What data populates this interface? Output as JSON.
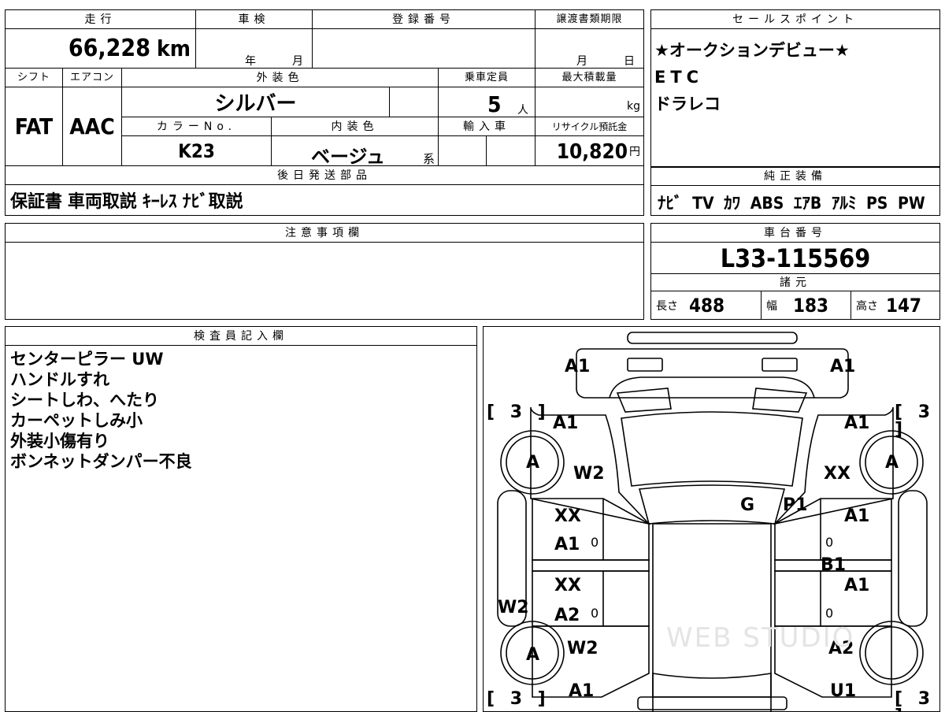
{
  "main": {
    "headers": {
      "mileage": "走行",
      "inspection": "車検",
      "registration_no": "登録番号",
      "transfer_deadline": "譲渡書類期限",
      "shift": "シフト",
      "aircon": "エアコン",
      "exterior_color": "外装色",
      "capacity": "乗車定員",
      "max_load": "最大積載量",
      "color_no": "カラーNo.",
      "interior_color": "内装色",
      "import": "輸入車",
      "recycle_fee": "リサイクル預託金",
      "later_parts": "後日発送部品"
    },
    "mileage_value": "66,228",
    "mileage_unit": "km",
    "inspection_year": "年",
    "inspection_month": "月",
    "transfer_month": "月",
    "transfer_day": "日",
    "shift_value": "FAT",
    "aircon_value": "AAC",
    "exterior_color_value": "シルバー",
    "capacity_value": "5",
    "capacity_unit": "人",
    "max_load_unit": "kg",
    "color_no_value": "K23",
    "interior_color_value": "ベージュ",
    "interior_color_suffix": "系",
    "recycle_fee_value": "10,820",
    "recycle_fee_unit": "円",
    "later_parts_value": "保証書 車両取説 ｷｰﾚｽ ﾅﾋﾞ取説"
  },
  "sales": {
    "header": "セールスポイント",
    "lines": [
      "★オークションデビュー★",
      "ETC",
      "ドラレコ"
    ]
  },
  "equipment": {
    "header": "純正装備",
    "value": "ﾅﾋﾞ TV ｶﾜ ABS ｴｱB ｱﾙﾐ PS PW"
  },
  "notes": {
    "header": "注意事項欄"
  },
  "chassis": {
    "header": "車台番号",
    "value": "L33-115569",
    "specs_header": "諸元",
    "length_label": "長さ",
    "length_value": "488",
    "width_label": "幅",
    "width_value": "183",
    "height_label": "高さ",
    "height_value": "147"
  },
  "inspector": {
    "header": "検査員記入欄",
    "lines": [
      "センターピラー UW",
      "ハンドルすれ",
      "シートしわ、へたり",
      "カーペットしみ小",
      "外装小傷有り",
      "ボンネットダンパー不良"
    ]
  },
  "diagram": {
    "marks": {
      "front_left": "A1",
      "front_right": "A1",
      "fender_fl": "A1",
      "fender_fr": "A1",
      "tire_fl": "A",
      "tire_fr": "A",
      "tire_rl": "A",
      "w2_fl": "W2",
      "xx_fr": "XX",
      "g": "G",
      "p1": "P1",
      "door_fl_1": "XX",
      "door_fl_2": "A1",
      "door_fr": "A1",
      "door_rl_1": "XX",
      "door_rl_2": "A2",
      "door_rr": "A1",
      "b1": "B1",
      "w2_side": "W2",
      "w2_rl": "W2",
      "quarter_rr": "A2",
      "rear_left": "A1",
      "rear_right": "U1",
      "small_0": "0"
    },
    "tire_tread": "[ 3 ]",
    "watermark": "WEB STUDIO"
  }
}
